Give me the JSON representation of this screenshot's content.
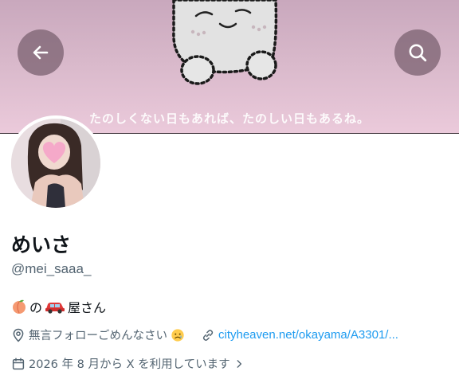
{
  "header": {
    "banner_caption": "たのしくない日もあれば、たのしい日もあるね。",
    "back_icon": "arrow-left-icon",
    "search_icon": "search-icon"
  },
  "profile": {
    "display_name": "めいさ",
    "handle": "@mei_saaa_",
    "bio": {
      "parts": [
        "peach-emoji",
        "の",
        "car-emoji",
        "屋さん"
      ],
      "text_no": "の",
      "text_shop": "屋さん"
    },
    "location": "無言フォローごめんなさい",
    "location_emoji": "sad-face-emoji",
    "link": "cityheaven.net/okayama/A3301/...",
    "joined": "2026 年 8 月から X を利用しています",
    "joined_chevron": "chevron-right-icon"
  },
  "colors": {
    "banner_top": "#c9a8bd",
    "banner_bottom": "#ebcadb",
    "link": "#1d9bf0",
    "secondary_text": "#536471",
    "primary_text": "#0f1419"
  }
}
